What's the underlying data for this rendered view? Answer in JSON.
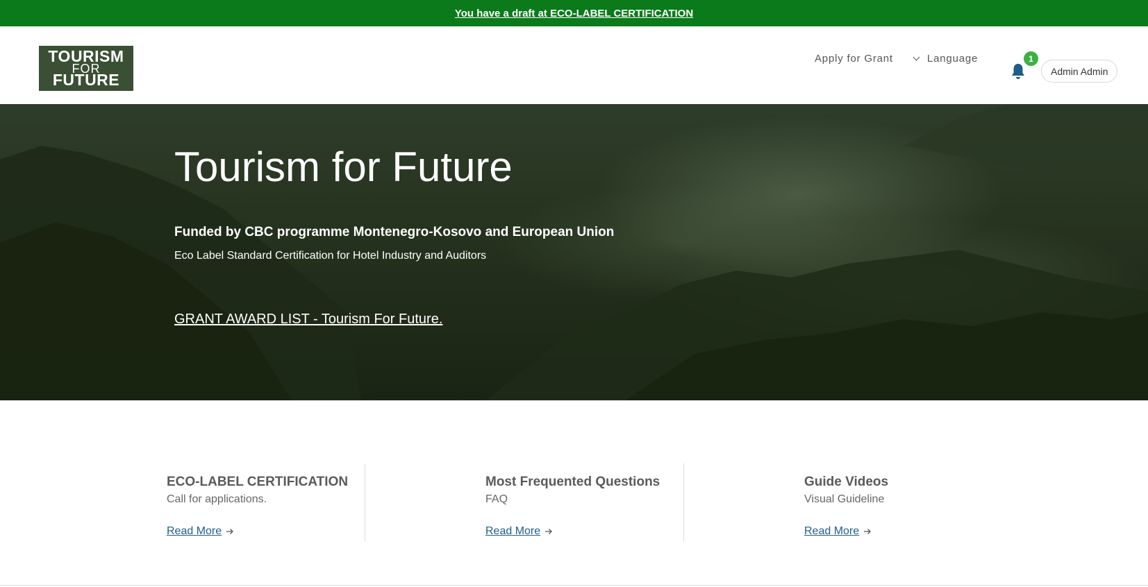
{
  "draft_banner": {
    "text": "You have a draft at ECO-LABEL CERTIFICATION"
  },
  "logo": {
    "line1": "TOURISM",
    "line2": "FOR",
    "line3": "FUTURE"
  },
  "nav": {
    "apply_label": "Apply for Grant",
    "language_label": "Language",
    "notification_count": "1",
    "user_label": "Admin Admin"
  },
  "hero": {
    "title": "Tourism for Future",
    "subtitle": "Funded by CBC programme Montenegro-Kosovo and European Union",
    "description": "Eco Label Standard Certification for Hotel Industry and Auditors",
    "link": "GRANT AWARD LIST - Tourism For Future."
  },
  "cards": [
    {
      "title": "ECO-LABEL CERTIFICATION",
      "subtitle": "Call for applications.",
      "link": "Read More"
    },
    {
      "title": "Most Frequented Questions",
      "subtitle": "FAQ",
      "link": "Read More"
    },
    {
      "title": "Guide Videos",
      "subtitle": "Visual Guideline",
      "link": "Read More"
    }
  ],
  "colors": {
    "banner_green": "#0a7a1a",
    "logo_bg": "#3a4f33",
    "badge_green": "#3cb043",
    "bell_blue": "#1f5d8a",
    "link_blue": "#1f5d8a"
  }
}
